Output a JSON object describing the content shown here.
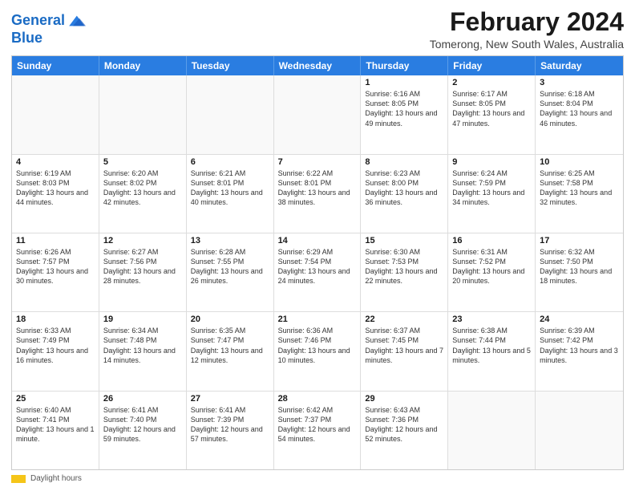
{
  "header": {
    "logo_line1": "General",
    "logo_line2": "Blue",
    "main_title": "February 2024",
    "subtitle": "Tomerong, New South Wales, Australia"
  },
  "calendar": {
    "days_of_week": [
      "Sunday",
      "Monday",
      "Tuesday",
      "Wednesday",
      "Thursday",
      "Friday",
      "Saturday"
    ],
    "rows": [
      [
        {
          "day": "",
          "content": ""
        },
        {
          "day": "",
          "content": ""
        },
        {
          "day": "",
          "content": ""
        },
        {
          "day": "",
          "content": ""
        },
        {
          "day": "1",
          "content": "Sunrise: 6:16 AM\nSunset: 8:05 PM\nDaylight: 13 hours and 49 minutes."
        },
        {
          "day": "2",
          "content": "Sunrise: 6:17 AM\nSunset: 8:05 PM\nDaylight: 13 hours and 47 minutes."
        },
        {
          "day": "3",
          "content": "Sunrise: 6:18 AM\nSunset: 8:04 PM\nDaylight: 13 hours and 46 minutes."
        }
      ],
      [
        {
          "day": "4",
          "content": "Sunrise: 6:19 AM\nSunset: 8:03 PM\nDaylight: 13 hours and 44 minutes."
        },
        {
          "day": "5",
          "content": "Sunrise: 6:20 AM\nSunset: 8:02 PM\nDaylight: 13 hours and 42 minutes."
        },
        {
          "day": "6",
          "content": "Sunrise: 6:21 AM\nSunset: 8:01 PM\nDaylight: 13 hours and 40 minutes."
        },
        {
          "day": "7",
          "content": "Sunrise: 6:22 AM\nSunset: 8:01 PM\nDaylight: 13 hours and 38 minutes."
        },
        {
          "day": "8",
          "content": "Sunrise: 6:23 AM\nSunset: 8:00 PM\nDaylight: 13 hours and 36 minutes."
        },
        {
          "day": "9",
          "content": "Sunrise: 6:24 AM\nSunset: 7:59 PM\nDaylight: 13 hours and 34 minutes."
        },
        {
          "day": "10",
          "content": "Sunrise: 6:25 AM\nSunset: 7:58 PM\nDaylight: 13 hours and 32 minutes."
        }
      ],
      [
        {
          "day": "11",
          "content": "Sunrise: 6:26 AM\nSunset: 7:57 PM\nDaylight: 13 hours and 30 minutes."
        },
        {
          "day": "12",
          "content": "Sunrise: 6:27 AM\nSunset: 7:56 PM\nDaylight: 13 hours and 28 minutes."
        },
        {
          "day": "13",
          "content": "Sunrise: 6:28 AM\nSunset: 7:55 PM\nDaylight: 13 hours and 26 minutes."
        },
        {
          "day": "14",
          "content": "Sunrise: 6:29 AM\nSunset: 7:54 PM\nDaylight: 13 hours and 24 minutes."
        },
        {
          "day": "15",
          "content": "Sunrise: 6:30 AM\nSunset: 7:53 PM\nDaylight: 13 hours and 22 minutes."
        },
        {
          "day": "16",
          "content": "Sunrise: 6:31 AM\nSunset: 7:52 PM\nDaylight: 13 hours and 20 minutes."
        },
        {
          "day": "17",
          "content": "Sunrise: 6:32 AM\nSunset: 7:50 PM\nDaylight: 13 hours and 18 minutes."
        }
      ],
      [
        {
          "day": "18",
          "content": "Sunrise: 6:33 AM\nSunset: 7:49 PM\nDaylight: 13 hours and 16 minutes."
        },
        {
          "day": "19",
          "content": "Sunrise: 6:34 AM\nSunset: 7:48 PM\nDaylight: 13 hours and 14 minutes."
        },
        {
          "day": "20",
          "content": "Sunrise: 6:35 AM\nSunset: 7:47 PM\nDaylight: 13 hours and 12 minutes."
        },
        {
          "day": "21",
          "content": "Sunrise: 6:36 AM\nSunset: 7:46 PM\nDaylight: 13 hours and 10 minutes."
        },
        {
          "day": "22",
          "content": "Sunrise: 6:37 AM\nSunset: 7:45 PM\nDaylight: 13 hours and 7 minutes."
        },
        {
          "day": "23",
          "content": "Sunrise: 6:38 AM\nSunset: 7:44 PM\nDaylight: 13 hours and 5 minutes."
        },
        {
          "day": "24",
          "content": "Sunrise: 6:39 AM\nSunset: 7:42 PM\nDaylight: 13 hours and 3 minutes."
        }
      ],
      [
        {
          "day": "25",
          "content": "Sunrise: 6:40 AM\nSunset: 7:41 PM\nDaylight: 13 hours and 1 minute."
        },
        {
          "day": "26",
          "content": "Sunrise: 6:41 AM\nSunset: 7:40 PM\nDaylight: 12 hours and 59 minutes."
        },
        {
          "day": "27",
          "content": "Sunrise: 6:41 AM\nSunset: 7:39 PM\nDaylight: 12 hours and 57 minutes."
        },
        {
          "day": "28",
          "content": "Sunrise: 6:42 AM\nSunset: 7:37 PM\nDaylight: 12 hours and 54 minutes."
        },
        {
          "day": "29",
          "content": "Sunrise: 6:43 AM\nSunset: 7:36 PM\nDaylight: 12 hours and 52 minutes."
        },
        {
          "day": "",
          "content": ""
        },
        {
          "day": "",
          "content": ""
        }
      ]
    ]
  },
  "footer": {
    "daylight_label": "Daylight hours"
  }
}
